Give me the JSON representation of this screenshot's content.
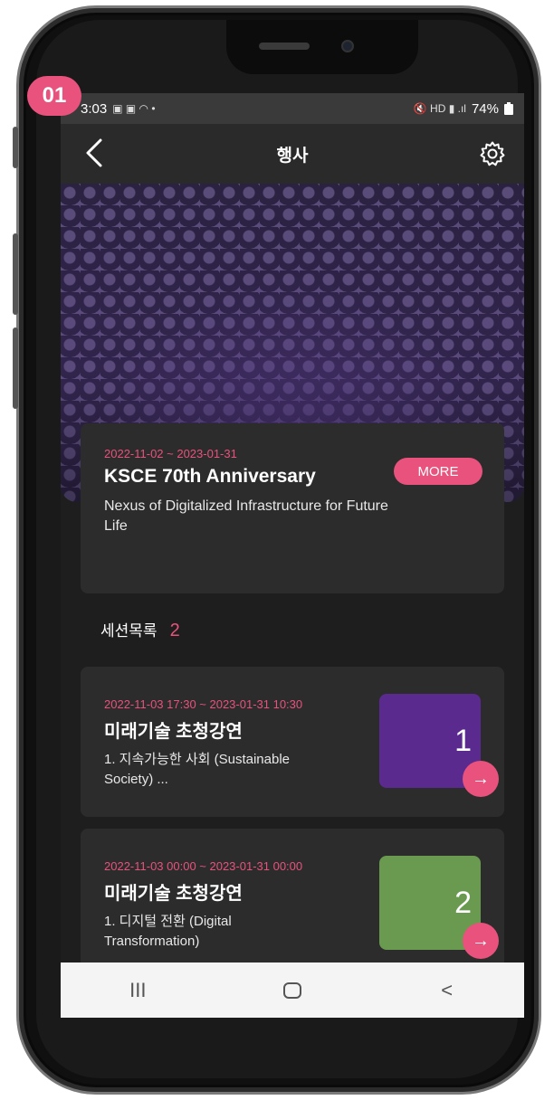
{
  "overlay": {
    "step_badge": "01"
  },
  "statusbar": {
    "time": "3:03",
    "left_icons": "▣ ▣ ◠ •",
    "right_icons": "🔇 HD ▮ .ıl",
    "battery": "74%"
  },
  "appbar": {
    "title": "행사"
  },
  "event": {
    "date_range": "2022-11-02 ~ 2023-01-31",
    "title": "KSCE 70th Anniversary",
    "description": "Nexus of Digitalized Infrastructure for Future Life",
    "more_label": "MORE"
  },
  "sessions_header": {
    "label": "세션목록",
    "count": "2"
  },
  "sessions": [
    {
      "date_range": "2022-11-03 17:30 ~ 2023-01-31 10:30",
      "title": "미래기술 초청강연",
      "description": "1. 지속가능한 사회 (Sustainable Society) ...",
      "number": "1",
      "thumb_color": "#5a2a8f",
      "arrow": "→"
    },
    {
      "date_range": "2022-11-03 00:00 ~ 2023-01-31 00:00",
      "title": "미래기술 초청강연",
      "description": "1. 디지털 전환 (Digital Transformation)",
      "number": "2",
      "thumb_color": "#6a9a4f",
      "arrow": "→"
    }
  ],
  "navbar": {
    "recents": "III",
    "back": "<"
  },
  "colors": {
    "accent": "#e8527c",
    "background": "#1f1e1f",
    "card": "#2d2c2d"
  }
}
